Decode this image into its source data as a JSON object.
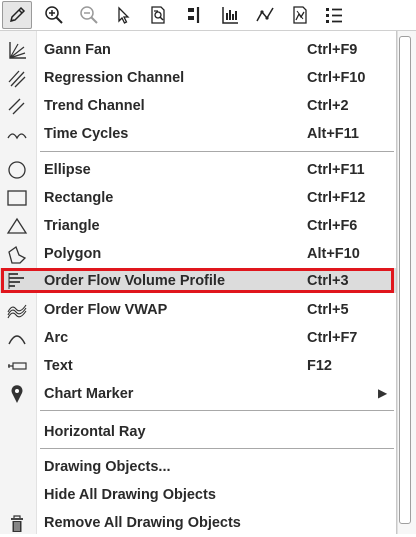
{
  "toolbar": {
    "buttons": [
      {
        "icon": "pencil-icon",
        "active": true
      },
      {
        "icon": "zoom-in-icon"
      },
      {
        "icon": "zoom-out-icon"
      },
      {
        "icon": "cursor-icon"
      },
      {
        "icon": "data-box-icon"
      },
      {
        "icon": "flag-bars-icon"
      },
      {
        "icon": "bar-chart-icon"
      },
      {
        "icon": "line-chart-icon"
      },
      {
        "icon": "indicator-icon"
      },
      {
        "icon": "list-icon"
      }
    ]
  },
  "menu": {
    "items": [
      {
        "label": "Gann Fan",
        "shortcut": "Ctrl+F9",
        "icon": "gann-fan-icon"
      },
      {
        "label": "Regression Channel",
        "shortcut": "Ctrl+F10",
        "icon": "regression-channel-icon"
      },
      {
        "label": "Trend Channel",
        "shortcut": "Ctrl+2",
        "icon": "trend-channel-icon"
      },
      {
        "label": "Time Cycles",
        "shortcut": "Alt+F11",
        "icon": "time-cycles-icon"
      },
      {
        "label": "Ellipse",
        "shortcut": "Ctrl+F11",
        "icon": "ellipse-icon"
      },
      {
        "label": "Rectangle",
        "shortcut": "Ctrl+F12",
        "icon": "rectangle-icon"
      },
      {
        "label": "Triangle",
        "shortcut": "Ctrl+F6",
        "icon": "triangle-icon"
      },
      {
        "label": "Polygon",
        "shortcut": "Alt+F10",
        "icon": "polygon-icon"
      },
      {
        "label": "Order Flow Volume Profile",
        "shortcut": "Ctrl+3",
        "icon": "volume-profile-icon",
        "highlighted": true
      },
      {
        "label": "Order Flow VWAP",
        "shortcut": "Ctrl+5",
        "icon": "vwap-icon"
      },
      {
        "label": "Arc",
        "shortcut": "Ctrl+F7",
        "icon": "arc-icon"
      },
      {
        "label": "Text",
        "shortcut": "F12",
        "icon": "text-icon"
      },
      {
        "label": "Chart Marker",
        "shortcut": "",
        "icon": "map-pin-icon",
        "submenu": true
      },
      {
        "label": "Horizontal Ray",
        "shortcut": "",
        "icon": ""
      },
      {
        "label": "Drawing Objects...",
        "shortcut": "",
        "icon": ""
      },
      {
        "label": "Hide All Drawing Objects",
        "shortcut": "",
        "icon": ""
      },
      {
        "label": "Remove All Drawing Objects",
        "shortcut": "",
        "icon": "trash-icon"
      }
    ],
    "submenu_arrow": "▶"
  },
  "colors": {
    "highlight_border": "#e0161d",
    "highlight_fill": "#dcdcdc"
  }
}
